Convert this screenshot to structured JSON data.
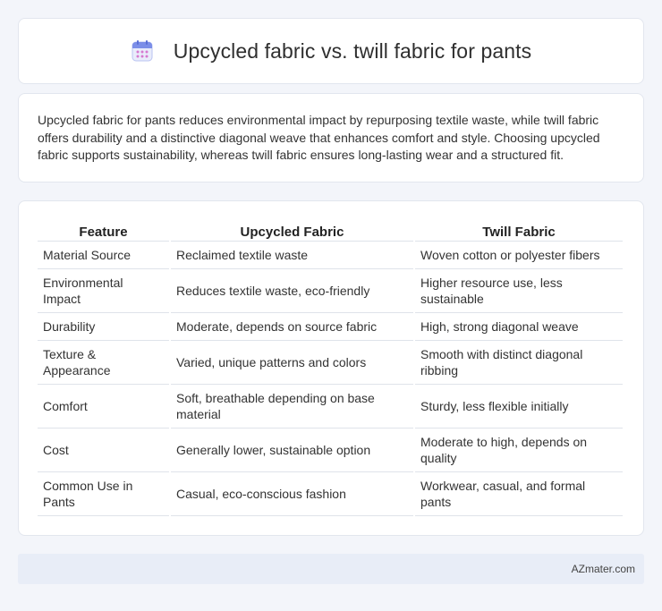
{
  "header": {
    "title": "Upcycled fabric vs. twill fabric for pants",
    "icon": "calendar-icon"
  },
  "intro": {
    "text": "Upcycled fabric for pants reduces environmental impact by repurposing textile waste, while twill fabric offers durability and a distinctive diagonal weave that enhances comfort and style. Choosing upcycled fabric supports sustainability, whereas twill fabric ensures long-lasting wear and a structured fit."
  },
  "table": {
    "headers": [
      "Feature",
      "Upcycled Fabric",
      "Twill Fabric"
    ],
    "rows": [
      [
        "Material Source",
        "Reclaimed textile waste",
        "Woven cotton or polyester fibers"
      ],
      [
        "Environmental Impact",
        "Reduces textile waste, eco-friendly",
        "Higher resource use, less sustainable"
      ],
      [
        "Durability",
        "Moderate, depends on source fabric",
        "High, strong diagonal weave"
      ],
      [
        "Texture & Appearance",
        "Varied, unique patterns and colors",
        "Smooth with distinct diagonal ribbing"
      ],
      [
        "Comfort",
        "Soft, breathable depending on base material",
        "Sturdy, less flexible initially"
      ],
      [
        "Cost",
        "Generally lower, sustainable option",
        "Moderate to high, depends on quality"
      ],
      [
        "Common Use in Pants",
        "Casual, eco-conscious fashion",
        "Workwear, casual, and formal pants"
      ]
    ]
  },
  "footer": {
    "text": "AZmater.com"
  },
  "colors": {
    "page_background": "#f3f5fa",
    "card_background": "#ffffff",
    "footer_background": "#e8edf7",
    "icon_accent": "#7b8ee8"
  }
}
